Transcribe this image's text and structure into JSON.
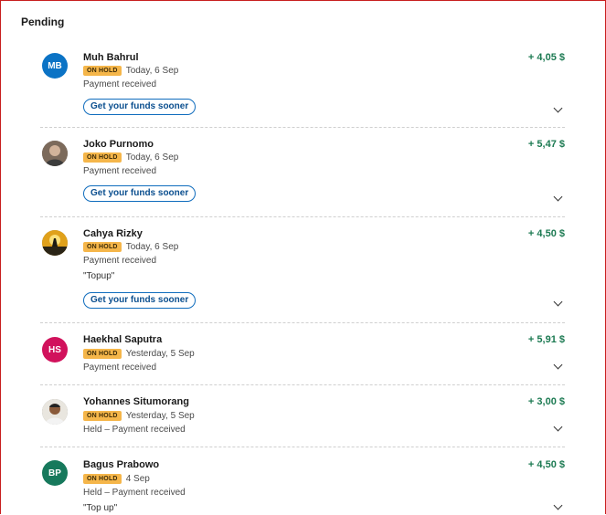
{
  "section": {
    "title": "Pending"
  },
  "colors": {
    "amount": "#1c7a52",
    "badge": "#f5b64a",
    "button_border": "#0f6cbd"
  },
  "transactions": [
    {
      "name": "Muh Bahrul",
      "initials": "MB",
      "avatar_color": "#0b73c5",
      "amount": "+ 4,05 $",
      "badge": "ON HOLD",
      "date": "Today, 6 Sep",
      "description": "Payment received",
      "note": "",
      "button_label": "Get your funds sooner"
    },
    {
      "name": "Joko Purnomo",
      "initials": "",
      "avatar_icon": "person-photo",
      "amount": "+ 5,47 $",
      "badge": "ON HOLD",
      "date": "Today, 6 Sep",
      "description": "Payment received",
      "note": "",
      "button_label": "Get your funds sooner"
    },
    {
      "name": "Cahya Rizky",
      "initials": "",
      "avatar_icon": "landscape-photo",
      "amount": "+ 4,50 $",
      "badge": "ON HOLD",
      "date": "Today, 6 Sep",
      "description": "Payment received",
      "note": "\"Topup\"",
      "button_label": "Get your funds sooner"
    },
    {
      "name": "Haekhal Saputra",
      "initials": "HS",
      "avatar_color": "#d1125c",
      "amount": "+ 5,91 $",
      "badge": "ON HOLD",
      "date": "Yesterday, 5 Sep",
      "description": "Payment received",
      "note": "",
      "button_label": ""
    },
    {
      "name": "Yohannes Situmorang",
      "initials": "",
      "avatar_icon": "person-photo",
      "amount": "+ 3,00 $",
      "badge": "ON HOLD",
      "date": "Yesterday, 5 Sep",
      "description": "Held – Payment received",
      "note": "",
      "button_label": ""
    },
    {
      "name": "Bagus Prabowo",
      "initials": "BP",
      "avatar_color": "#17795c",
      "amount": "+ 4,50 $",
      "badge": "ON HOLD",
      "date": "4 Sep",
      "description": "Held – Payment received",
      "note": "\"Top up\"",
      "button_label": ""
    }
  ]
}
